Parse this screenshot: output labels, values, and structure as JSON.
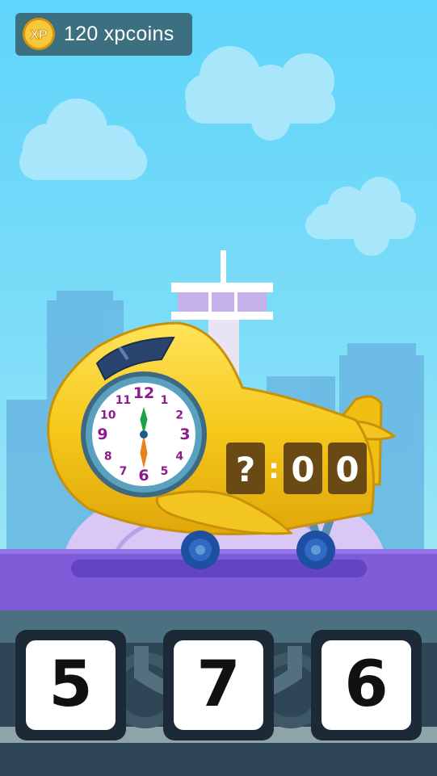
{
  "hud": {
    "xp_coin_label": "XP",
    "xp_amount": "120",
    "xp_unit": "xpcoins"
  },
  "clock": {
    "numbers": [
      "12",
      "1",
      "2",
      "3",
      "4",
      "5",
      "6",
      "7",
      "8",
      "9",
      "10",
      "11"
    ],
    "hour_hand_points_to": 6,
    "minute_hand_points_to": 12
  },
  "digital_display": {
    "hour": "?",
    "separator": ":",
    "minute_tens": "0",
    "minute_ones": "0"
  },
  "answers": [
    {
      "label": "5"
    },
    {
      "label": "7"
    },
    {
      "label": "6"
    }
  ],
  "colors": {
    "sky": "#5fd4fa",
    "plane_yellow": "#f2c418",
    "runway_purple": "#7d59d6",
    "clock_numbers": "#8a1c8c",
    "hour_hand": "#e8811c",
    "minute_hand": "#1fa14a",
    "answer_frame": "#1c2a38"
  }
}
